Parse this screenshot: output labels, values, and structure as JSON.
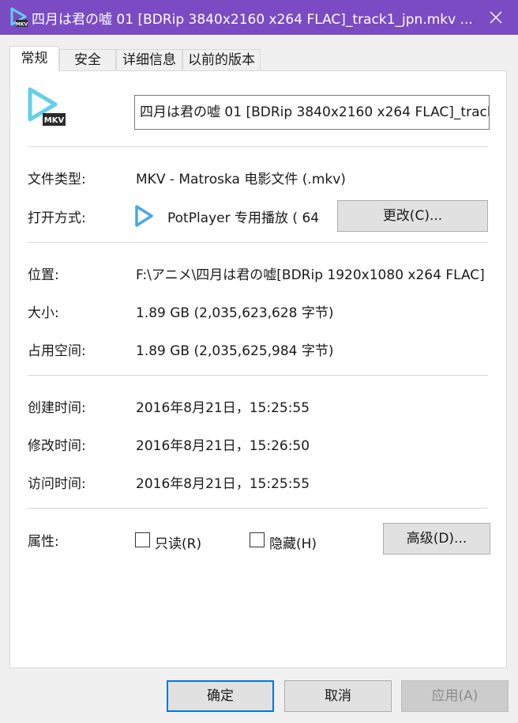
{
  "window": {
    "title": "四月は君の嘘 01 [BDRip 3840x2160 x264 FLAC]_track1_jpn.mkv ...",
    "app_icon": "mkv-play-icon",
    "close_icon": "close-icon",
    "accent_color": "#7b4bc4"
  },
  "tabs": [
    {
      "label": "常规",
      "active": true
    },
    {
      "label": "安全",
      "active": false
    },
    {
      "label": "详细信息",
      "active": false
    },
    {
      "label": "以前的版本",
      "active": false
    }
  ],
  "general": {
    "file_icon": "mkv-file-icon",
    "file_icon_text": "MKV",
    "file_name": "四月は君の嘘 01 [BDRip 3840x2160 x264 FLAC]_track1_jpn.mkv",
    "file_type_label": "文件类型:",
    "file_type_value": "MKV - Matroska 电影文件 (.mkv)",
    "opens_with_label": "打开方式:",
    "opens_with_value": "PotPlayer 专用播放 ( 64",
    "opens_with_icon": "potplayer-icon",
    "change_button": "更改(C)...",
    "location_label": "位置:",
    "location_value": "F:\\アニメ\\四月は君の嘘[BDRip 1920x1080 x264 FLAC]",
    "size_label": "大小:",
    "size_value": "1.89 GB (2,035,623,628 字节)",
    "size_on_disk_label": "占用空间:",
    "size_on_disk_value": "1.89 GB (2,035,625,984 字节)",
    "created_label": "创建时间:",
    "created_value": "2016年8月21日，15:25:55",
    "modified_label": "修改时间:",
    "modified_value": "2016年8月21日，15:26:50",
    "accessed_label": "访问时间:",
    "accessed_value": "2016年8月21日，15:25:55",
    "attributes_label": "属性:",
    "readonly_label": "只读(R)",
    "readonly_checked": false,
    "hidden_label": "隐藏(H)",
    "hidden_checked": false,
    "advanced_button": "高级(D)..."
  },
  "footer": {
    "ok_button": "确定",
    "cancel_button": "取消",
    "apply_button": "应用(A)"
  }
}
